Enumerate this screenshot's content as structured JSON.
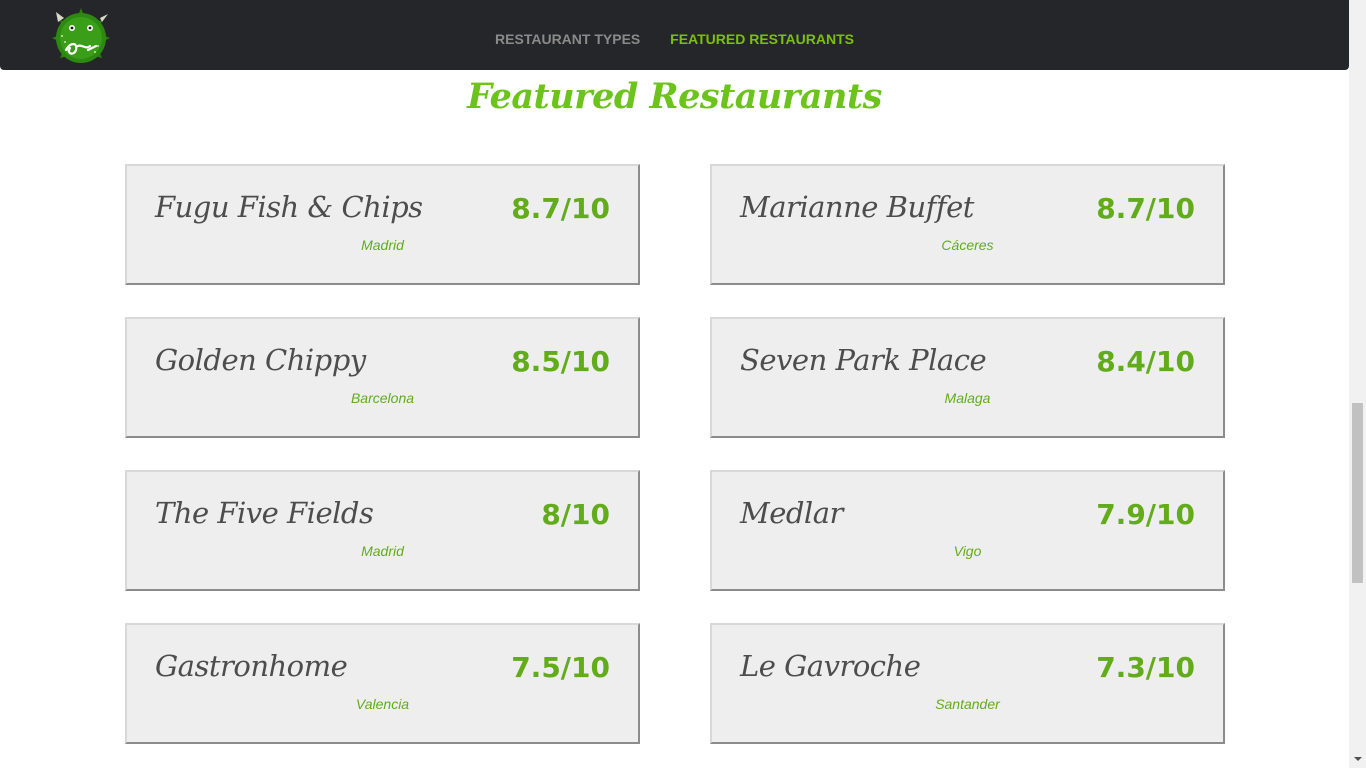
{
  "nav": {
    "logo_text": "fugu",
    "links": [
      {
        "label": "RESTAURANT TYPES",
        "active": false
      },
      {
        "label": "FEATURED RESTAURANTS",
        "active": true
      }
    ]
  },
  "page": {
    "title": "Featured Restaurants"
  },
  "restaurants": [
    {
      "name": "Fugu Fish & Chips",
      "score": "8.7/10",
      "city": "Madrid"
    },
    {
      "name": "Marianne Buffet",
      "score": "8.7/10",
      "city": "Cáceres"
    },
    {
      "name": "Golden Chippy",
      "score": "8.5/10",
      "city": "Barcelona"
    },
    {
      "name": "Seven Park Place",
      "score": "8.4/10",
      "city": "Malaga"
    },
    {
      "name": "The Five Fields",
      "score": "8/10",
      "city": "Madrid"
    },
    {
      "name": "Medlar",
      "score": "7.9/10",
      "city": "Vigo"
    },
    {
      "name": "Gastronhome",
      "score": "7.5/10",
      "city": "Valencia"
    },
    {
      "name": "Le Gavroche",
      "score": "7.3/10",
      "city": "Santander"
    }
  ],
  "colors": {
    "accent": "#7ac10e",
    "navbar": "#252629",
    "card": "#eeeeee"
  }
}
